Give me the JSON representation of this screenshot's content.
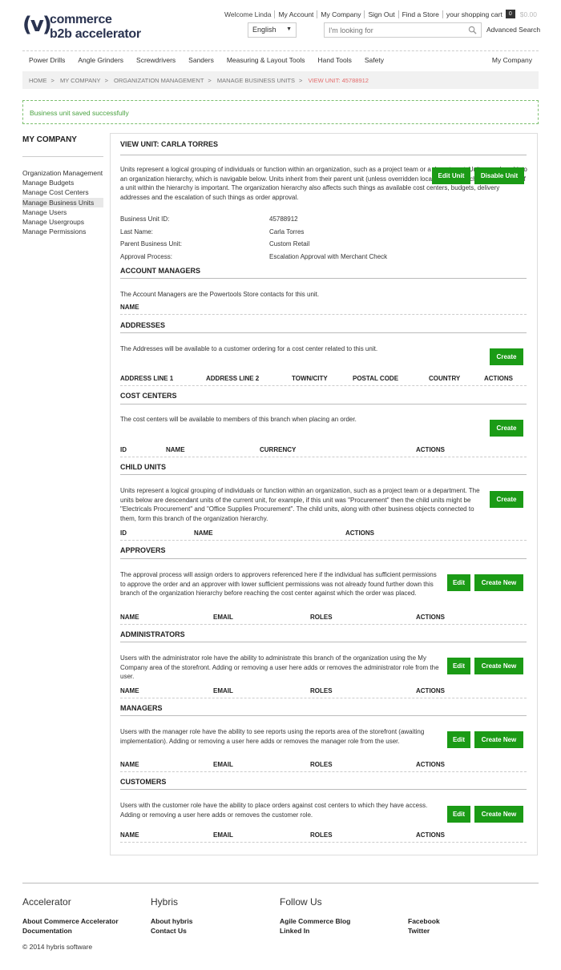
{
  "logo": {
    "mark": "(v)",
    "line1": "commerce",
    "line2": "b2b accelerator"
  },
  "top": {
    "welcome": "Welcome Linda",
    "my_account": "My Account",
    "my_company": "My Company",
    "sign_out": "Sign Out",
    "find_store": "Find a Store",
    "cart": "your shopping cart",
    "cart_count": "0",
    "cart_value": "$0.00"
  },
  "language": {
    "selected": "English"
  },
  "search": {
    "placeholder": "I'm looking for",
    "advanced": "Advanced Search"
  },
  "nav": {
    "items": [
      "Power Drills",
      "Angle Grinders",
      "Screwdrivers",
      "Sanders",
      "Measuring & Layout Tools",
      "Hand Tools",
      "Safety"
    ],
    "right": "My Company"
  },
  "breadcrumb": {
    "home": "HOME",
    "my_company": "MY COMPANY",
    "org": "ORGANIZATION MANAGEMENT",
    "manage": "MANAGE BUSINESS UNITS",
    "current": "VIEW UNIT: 45788912"
  },
  "alert": "Business unit saved successfully",
  "sidebar": {
    "title": "MY COMPANY",
    "items": [
      "Organization Management",
      "Manage Budgets",
      "Manage Cost Centers",
      "Manage Business Units",
      "Manage Users",
      "Manage Usergroups",
      "Manage Permissions"
    ]
  },
  "unit": {
    "title": "VIEW UNIT: CARLA TORRES",
    "description": "Units represent a logical grouping of individuals or function within an organization, such as a project team or a department. Units are placed into an organization hierarchy, which is navigable below. Units inherit from their parent unit (unless overridden locally) and as such the placement of a unit within the hierarchy is important. The organization hierarchy also affects such things as available cost centers, budgets, delivery addresses and the escalation of such things as order approval.",
    "edit_btn": "Edit Unit",
    "disable_btn": "Disable Unit",
    "fields": [
      {
        "label": "Business Unit ID:",
        "value": "45788912"
      },
      {
        "label": "Last Name:",
        "value": "Carla Torres"
      },
      {
        "label": "Parent Business Unit:",
        "value": "Custom Retail"
      },
      {
        "label": "Approval Process:",
        "value": "Escalation Approval with Merchant Check"
      }
    ]
  },
  "account_managers": {
    "title": "ACCOUNT MANAGERS",
    "text": "The Account Managers are the Powertools Store contacts for this unit.",
    "col": "NAME"
  },
  "addresses": {
    "title": "ADDRESSES",
    "text": "The Addresses will be available to a customer ordering for a cost center related to this unit.",
    "btn": "Create",
    "cols": [
      "ADDRESS LINE 1",
      "ADDRESS LINE 2",
      "TOWN/CITY",
      "POSTAL CODE",
      "COUNTRY",
      "ACTIONS"
    ]
  },
  "cost_centers": {
    "title": "COST CENTERS",
    "text": "The cost centers will be available to members of this branch when placing an order.",
    "btn": "Create",
    "cols": [
      "ID",
      "NAME",
      "CURRENCY",
      "ACTIONS"
    ]
  },
  "child_units": {
    "title": "CHILD UNITS",
    "text": "Units represent a logical grouping of individuals or function within an organization, such as a project team or a department. The units below are descendant units of the current unit, for example, if this unit was \"Procurement\" then the child units might be \"Electricals Procurement\" and \"Office Supplies Procurement\". The child units, along with other business objects connected to them, form this branch of the organization hierarchy.",
    "btn": "Create",
    "cols": [
      "ID",
      "NAME",
      "ACTIONS"
    ]
  },
  "approvers": {
    "title": "APPROVERS",
    "text": "The approval process will assign orders to approvers referenced here if the individual has sufficient permissions to approve the order and an approver with lower sufficient permissions was not already found further down this branch of the organization hierarchy before reaching the cost center against which the order was placed.",
    "edit": "Edit",
    "create": "Create New",
    "cols": [
      "NAME",
      "EMAIL",
      "ROLES",
      "ACTIONS"
    ]
  },
  "administrators": {
    "title": "ADMINISTRATORS",
    "text": "Users with the administrator role have the ability to administrate this branch of the organization using the My Company area of the storefront. Adding or removing a user here adds or removes the administrator role from the user.",
    "edit": "Edit",
    "create": "Create New",
    "cols": [
      "NAME",
      "EMAIL",
      "ROLES",
      "ACTIONS"
    ]
  },
  "managers": {
    "title": "MANAGERS",
    "text": "Users with the manager role have the ability to see reports using the reports area of the storefront (awaiting implementation). Adding or removing a user here adds or removes the manager role from the user.",
    "edit": "Edit",
    "create": "Create New",
    "cols": [
      "NAME",
      "EMAIL",
      "ROLES",
      "ACTIONS"
    ]
  },
  "customers": {
    "title": "CUSTOMERS",
    "text": "Users with the customer role have the ability to place orders against cost centers to which they have access. Adding or removing a user here adds or removes the customer role.",
    "edit": "Edit",
    "create": "Create New",
    "cols": [
      "NAME",
      "EMAIL",
      "ROLES",
      "ACTIONS"
    ]
  },
  "footer": {
    "col1": {
      "title": "Accelerator",
      "links": [
        "About Commerce Accelerator",
        "Documentation"
      ]
    },
    "col2": {
      "title": "Hybris",
      "links": [
        "About hybris",
        "Contact Us"
      ]
    },
    "col3": {
      "title": "Follow Us",
      "links": [
        "Agile Commerce Blog",
        "Linked In"
      ]
    },
    "col4": {
      "links": [
        "Facebook",
        "Twitter"
      ]
    },
    "copyright": "© 2014 hybris software"
  },
  "colors": {
    "accent": "#1b9b16",
    "brand": "#2a3350",
    "breadcrumb_current": "#e36d6d",
    "success": "#4aa240"
  }
}
